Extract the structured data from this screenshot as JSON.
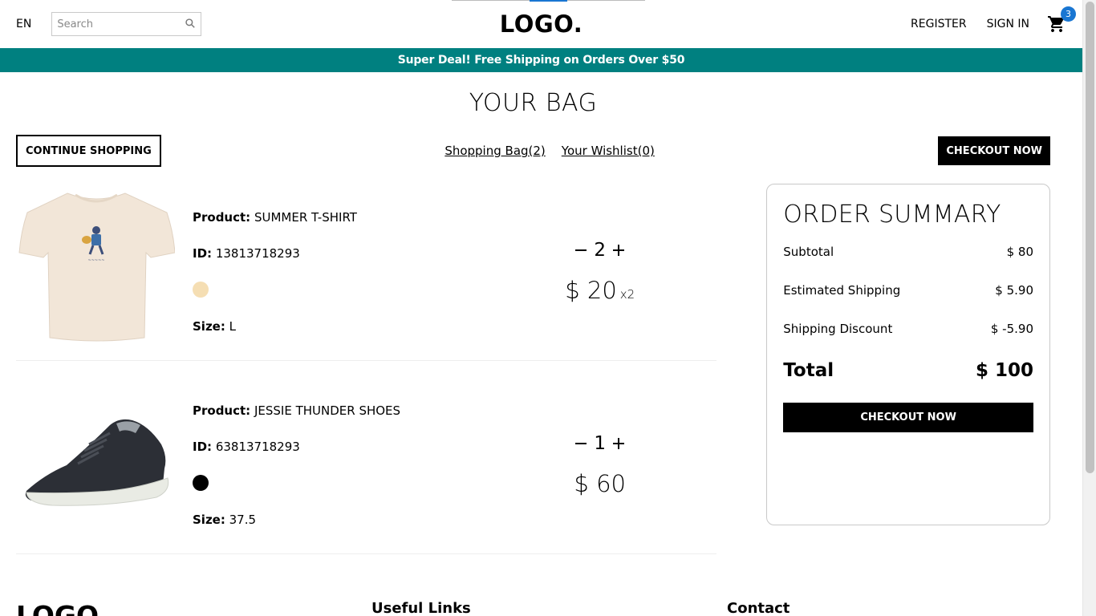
{
  "navbar": {
    "language": "EN",
    "search_placeholder": "Search",
    "logo": "LOGO.",
    "register": "REGISTER",
    "sign_in": "SIGN IN",
    "cart_count": "3"
  },
  "announcement": "Super Deal! Free Shipping on Orders Over $50",
  "bag": {
    "title": "YOUR BAG",
    "continue_button": "CONTINUE SHOPPING",
    "shopping_bag": "Shopping Bag(2)",
    "wishlist": "Your Wishlist(0)",
    "checkout_button": "CHECKOUT NOW"
  },
  "labels": {
    "product": "Product:",
    "id": "ID:",
    "size": "Size:"
  },
  "products": [
    {
      "name": "SUMMER T-SHIRT",
      "id": "13813718293",
      "color": "#f5deb3",
      "size": "L",
      "quantity": "2",
      "price": "$ 20",
      "multiplier": "x2"
    },
    {
      "name": "JESSIE THUNDER SHOES",
      "id": "63813718293",
      "color": "#000000",
      "size": "37.5",
      "quantity": "1",
      "price": "$ 60",
      "multiplier": ""
    }
  ],
  "summary": {
    "title": "ORDER SUMMARY",
    "subtotal_label": "Subtotal",
    "subtotal_value": "$ 80",
    "shipping_label": "Estimated Shipping",
    "shipping_value": "$ 5.90",
    "discount_label": "Shipping Discount",
    "discount_value": "$ -5.90",
    "total_label": "Total",
    "total_value": "$ 100",
    "checkout_button": "CHECKOUT NOW"
  },
  "footer": {
    "logo": "LOGO.",
    "useful_links": "Useful Links",
    "contact": "Contact"
  },
  "icons": {
    "search": "search-icon",
    "cart": "shopping-cart-icon",
    "minus": "minus-icon",
    "plus": "plus-icon"
  },
  "colors": {
    "announcement_bg": "#008080",
    "badge": "#1976d2"
  }
}
